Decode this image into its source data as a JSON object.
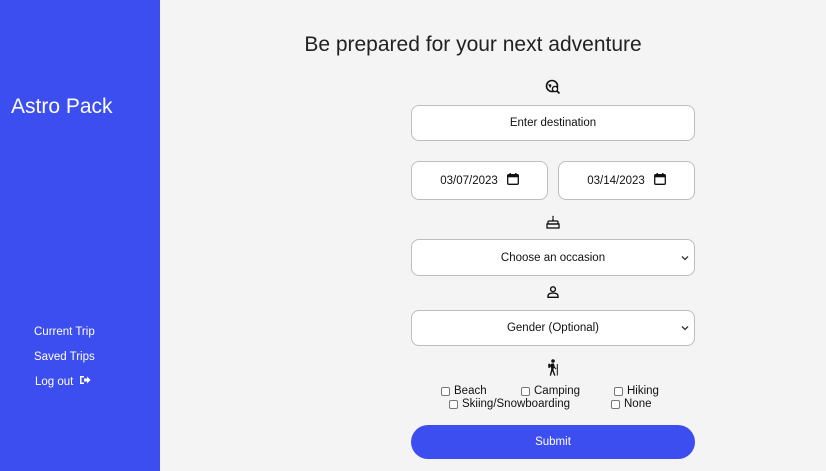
{
  "sidebar": {
    "brand": "Astro Pack",
    "nav": [
      {
        "label": "Current Trip"
      },
      {
        "label": "Saved Trips"
      },
      {
        "label": "Log out"
      }
    ]
  },
  "main": {
    "title": "Be prepared for your next adventure",
    "destination": {
      "placeholder": "Enter destination",
      "icon": "globe-search-icon"
    },
    "dates": {
      "start": "03/07/2023",
      "end": "03/14/2023",
      "icon": "calendar-icon"
    },
    "occasion": {
      "selected": "Choose an occasion",
      "icon": "cake-icon"
    },
    "gender": {
      "selected": "Gender (Optional)",
      "icon": "person-icon"
    },
    "activities": {
      "icon": "hiker-icon",
      "options": [
        "Beach",
        "Camping",
        "Hiking",
        "Skiing/Snowboarding",
        "None"
      ]
    },
    "submit_label": "Submit"
  },
  "colors": {
    "accent": "#3d4ef0",
    "background": "#f4f4f4"
  }
}
